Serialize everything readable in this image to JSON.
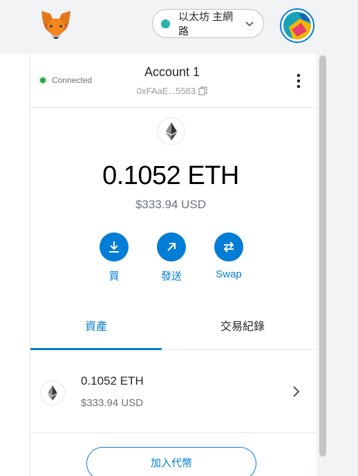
{
  "network": {
    "label": "以太坊 主網路",
    "dot_color": "#29b6af"
  },
  "account": {
    "status": "Connected",
    "name": "Account 1",
    "address": "0xFAaE...5583"
  },
  "balance": {
    "amount": "0.1052 ETH",
    "fiat": "$333.94 USD"
  },
  "actions": [
    {
      "label": "買",
      "icon": "download-icon"
    },
    {
      "label": "發送",
      "icon": "send-arrow-icon"
    },
    {
      "label": "Swap",
      "icon": "swap-icon"
    }
  ],
  "tabs": {
    "assets": "資產",
    "activity": "交易紀錄"
  },
  "assets": [
    {
      "amount": "0.1052 ETH",
      "fiat": "$333.94 USD",
      "icon": "eth-icon"
    }
  ],
  "add_token_label": "加入代幣",
  "colors": {
    "accent": "#037dd6",
    "connected": "#28a745"
  }
}
